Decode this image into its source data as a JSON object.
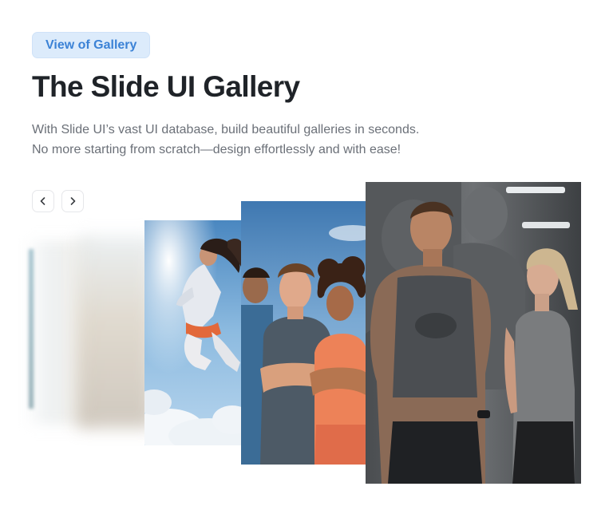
{
  "header": {
    "badge_label": "View of Gallery",
    "title": "The Slide UI Gallery",
    "subtitle_line1": "With Slide UI’s vast UI database, build beautiful galleries in seconds.",
    "subtitle_line2": "No more starting from scratch—design effortlessly and with ease!"
  },
  "navigation": {
    "prev_icon": "chevron-left-icon",
    "next_icon": "chevron-right-icon"
  },
  "colors": {
    "badge_bg": "#dcebfb",
    "badge_text": "#3b82d6",
    "title": "#1f2328",
    "subtitle": "#6b7078"
  }
}
